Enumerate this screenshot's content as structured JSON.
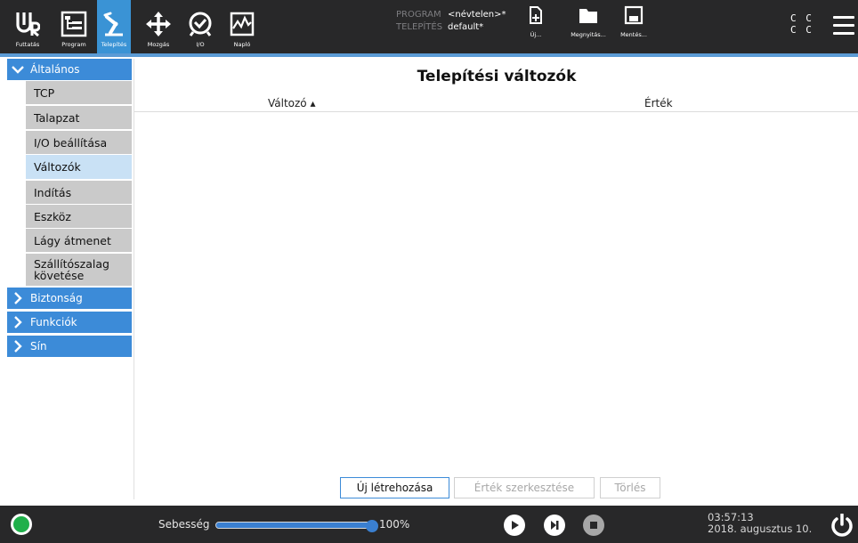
{
  "header": {
    "nav": [
      {
        "label": "Futtatás",
        "icon": "ur-logo-icon"
      },
      {
        "label": "Program",
        "icon": "program-tree-icon"
      },
      {
        "label": "Telepítés",
        "icon": "installation-arm-icon",
        "active": true
      },
      {
        "label": "Mozgás",
        "icon": "move-arrows-icon"
      },
      {
        "label": "I/O",
        "icon": "io-icon"
      },
      {
        "label": "Napló",
        "icon": "log-chart-icon"
      }
    ],
    "program_key": "PROGRAM",
    "program_value": "<névtelen>*",
    "installation_key": "TELEPÍTÉS",
    "installation_value": "default*",
    "file_buttons": [
      {
        "label": "Új...",
        "icon": "new-file-icon"
      },
      {
        "label": "Megnyitás...",
        "icon": "folder-icon"
      },
      {
        "label": "Mentés...",
        "icon": "save-icon"
      }
    ],
    "cc_top": "C C",
    "cc_bottom": "C C"
  },
  "sidebar": {
    "sections": [
      {
        "label": "Általános",
        "expanded": true
      },
      {
        "label": "Biztonság",
        "expanded": false
      },
      {
        "label": "Funkciók",
        "expanded": false
      },
      {
        "label": "Sín",
        "expanded": false
      }
    ],
    "items": [
      {
        "label": "TCP"
      },
      {
        "label": "Talapzat"
      },
      {
        "label": "I/O beállítása"
      },
      {
        "label": "Változók",
        "selected": true
      },
      {
        "label": "Indítás"
      },
      {
        "label": "Eszköz"
      },
      {
        "label": "Lágy átmenet"
      },
      {
        "label_line1": "Szállítószalag",
        "label_line2": "követése"
      }
    ]
  },
  "main": {
    "title": "Telepítési változók",
    "column_variable": "Változó ▴",
    "column_value": "Érték",
    "rows": [],
    "btn_new": "Új létrehozása",
    "btn_edit": "Érték szerkesztése",
    "btn_delete": "Törlés"
  },
  "footer": {
    "speed_label": "Sebesség",
    "speed_value": "100%",
    "speed_fraction": 1.0,
    "time": "03:57:13",
    "date": "2018. augusztus 10.",
    "status_color": "#1fb04a"
  },
  "colors": {
    "accent": "#3c8bd8",
    "header_bg": "#282829",
    "selected_item": "#c9e1f5"
  }
}
